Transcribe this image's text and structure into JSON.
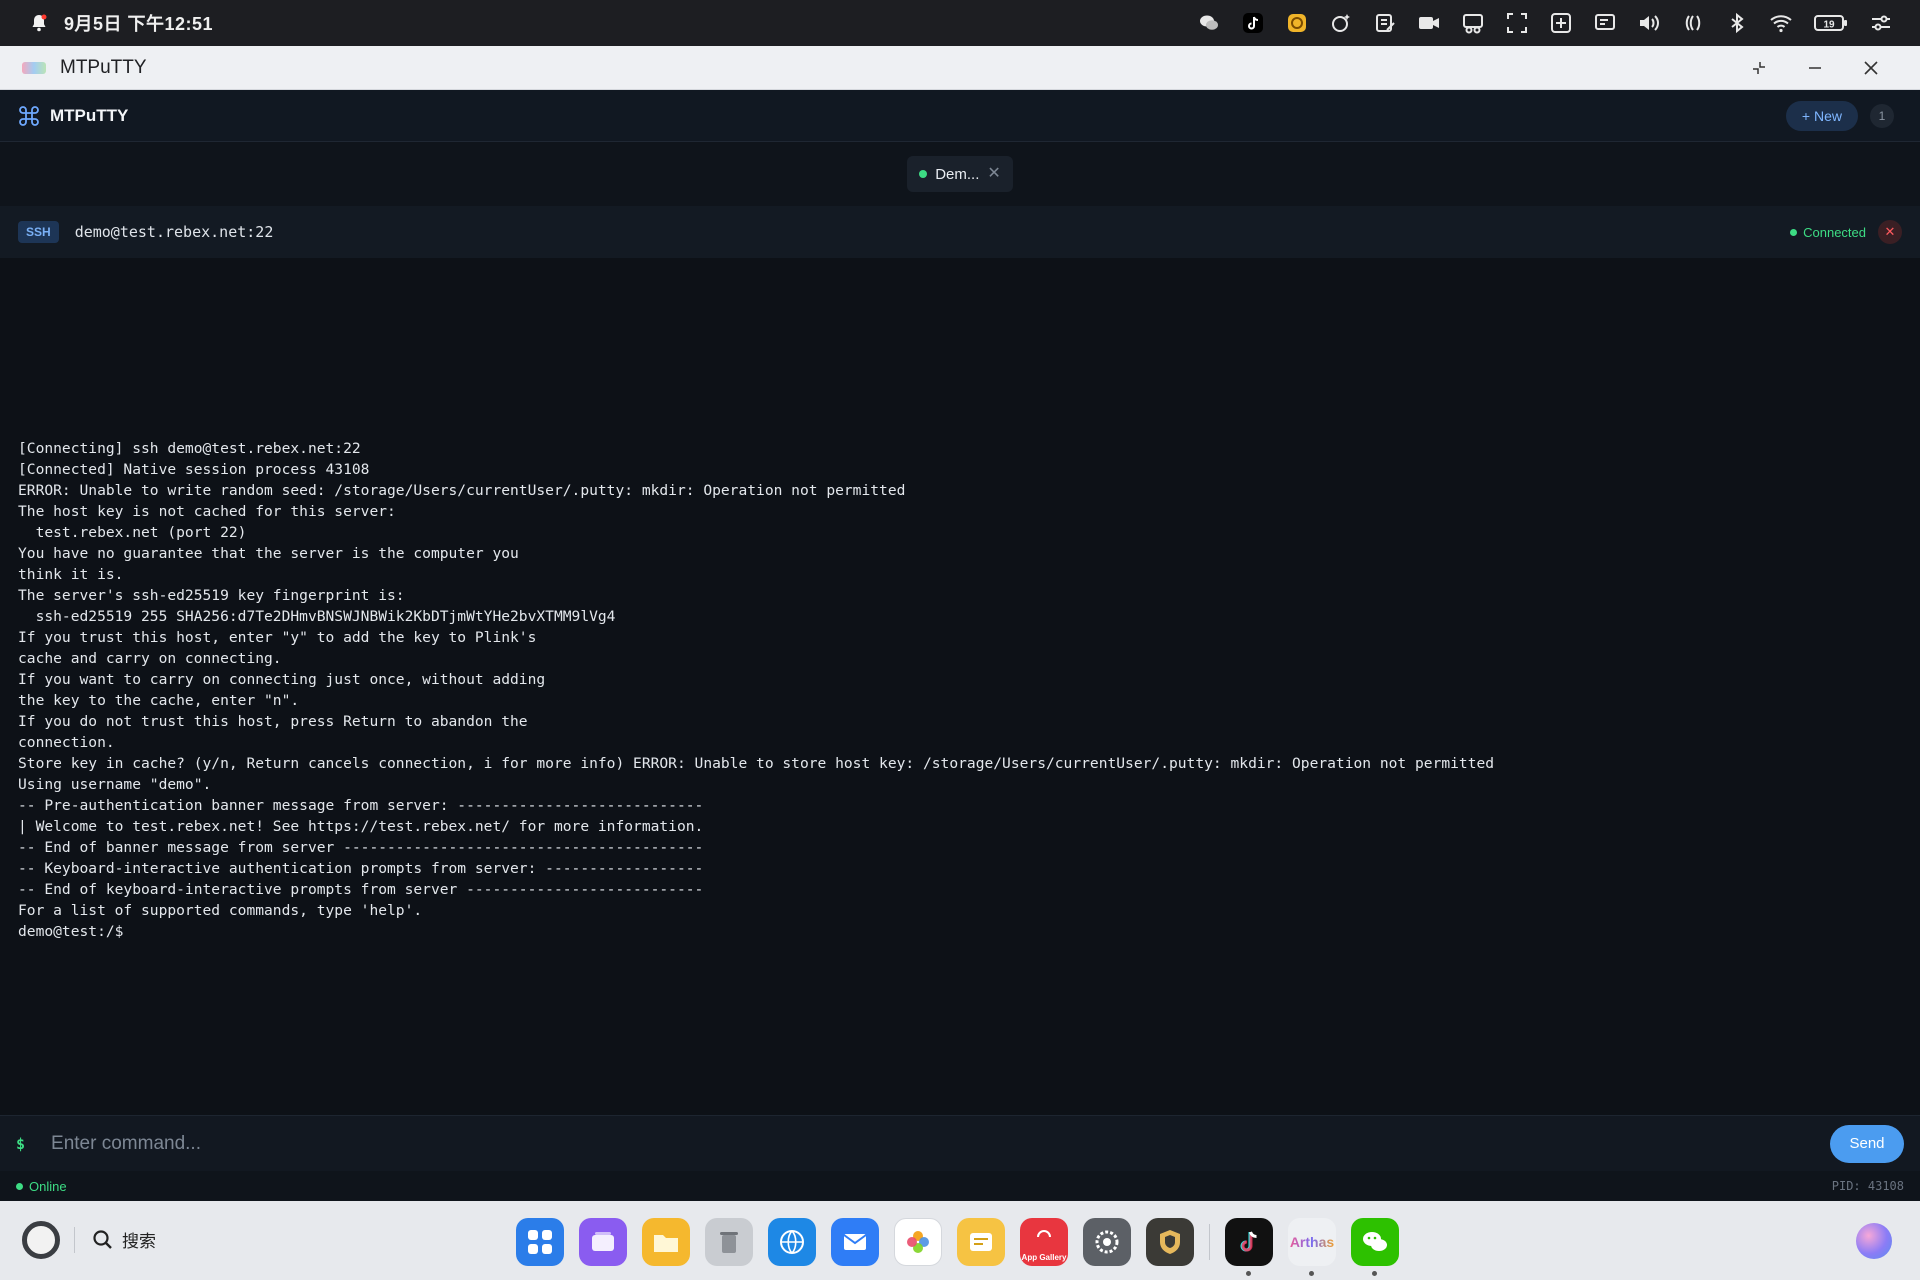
{
  "status_bar": {
    "clock": "9月5日 下午12:51",
    "battery": "19"
  },
  "window": {
    "title": "MTPuTTY"
  },
  "app_header": {
    "brand": "MTPuTTY",
    "new_button": "+ New",
    "session_count": "1"
  },
  "tabs": [
    {
      "label": "Dem...",
      "status_color": "#3ddc84"
    }
  ],
  "session": {
    "protocol": "SSH",
    "host": "demo@test.rebex.net:22",
    "status": "Connected"
  },
  "terminal": {
    "lines": [
      "[Connecting] ssh demo@test.rebex.net:22",
      "[Connected] Native session process 43108",
      "ERROR: Unable to write random seed: /storage/Users/currentUser/.putty: mkdir: Operation not permitted",
      "The host key is not cached for this server:",
      "  test.rebex.net (port 22)",
      "You have no guarantee that the server is the computer you",
      "think it is.",
      "The server's ssh-ed25519 key fingerprint is:",
      "  ssh-ed25519 255 SHA256:d7Te2DHmvBNSWJNBWik2KbDTjmWtYHe2bvXTMM9lVg4",
      "If you trust this host, enter \"y\" to add the key to Plink's",
      "cache and carry on connecting.",
      "If you want to carry on connecting just once, without adding",
      "the key to the cache, enter \"n\".",
      "If you do not trust this host, press Return to abandon the",
      "connection.",
      "Store key in cache? (y/n, Return cancels connection, i for more info) ERROR: Unable to store host key: /storage/Users/currentUser/.putty: mkdir: Operation not permitted",
      "Using username \"demo\".",
      "-- Pre-authentication banner message from server: ----------------------------",
      "| Welcome to test.rebex.net! See https://test.rebex.net/ for more information.",
      "-- End of banner message from server -----------------------------------------",
      "-- Keyboard-interactive authentication prompts from server: ------------------",
      "-- End of keyboard-interactive prompts from server ---------------------------",
      "For a list of supported commands, type 'help'.",
      "demo@test:/$"
    ]
  },
  "command_bar": {
    "prompt": "$",
    "placeholder": "Enter command...",
    "send_label": "Send"
  },
  "footer": {
    "status": "Online",
    "pid": "PID: 43108"
  },
  "dock": {
    "search_label": "搜索",
    "apps": [
      {
        "name": "app-center-icon",
        "color": "#2b7de9"
      },
      {
        "name": "multitask-icon",
        "color": "#8a5cf0"
      },
      {
        "name": "files-icon",
        "color": "#f5b82e"
      },
      {
        "name": "trash-icon",
        "color": "#c9ccd1"
      },
      {
        "name": "browser-icon",
        "color": "#1e88e5"
      },
      {
        "name": "mail-icon",
        "color": "#2f7df6"
      },
      {
        "name": "photos-icon",
        "color": "#ffffff"
      },
      {
        "name": "notes-icon",
        "color": "#f6c343"
      },
      {
        "name": "app-gallery-icon",
        "color": "#e8363f",
        "label": "App Gallery"
      },
      {
        "name": "settings-icon",
        "color": "#5c6066"
      },
      {
        "name": "shield-app-icon",
        "color": "#3b3a36"
      },
      {
        "name": "tiktok-icon",
        "color": "#111111"
      },
      {
        "name": "arthas-icon",
        "color": "#eef0f3",
        "label": "Arthas"
      },
      {
        "name": "wechat-icon",
        "color": "#2dc100"
      }
    ]
  }
}
